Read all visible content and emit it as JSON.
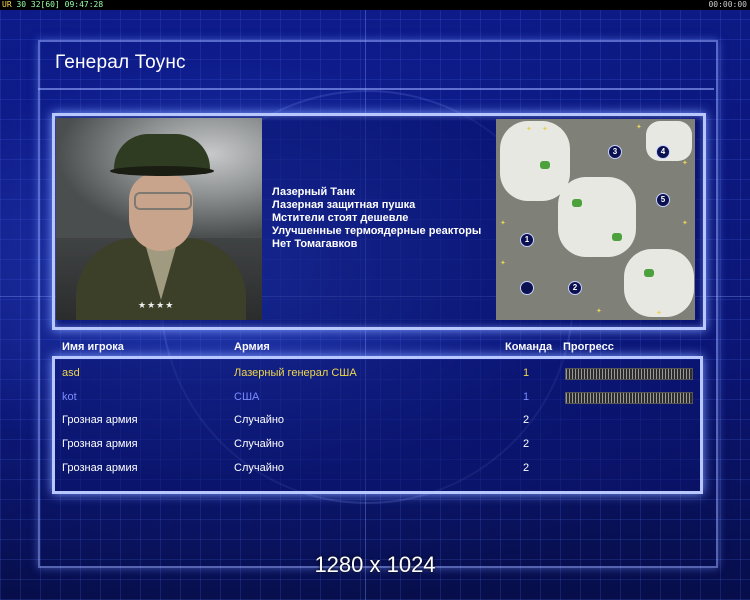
{
  "status_bar": {
    "left_prefix": "UR",
    "left_values": "30 32[60]",
    "clock": "09:47:28",
    "right_time": "00:00:00"
  },
  "title": "Генерал Тоунс",
  "general": {
    "features": [
      "Лазерный Танк",
      "Лазерная защитная пушка",
      "Мстители стоят дешевле",
      "Улучшенные термоядерные реакторы",
      "Нет Томагавков"
    ]
  },
  "map": {
    "slots": [
      "1",
      "2",
      "3",
      "4",
      "5",
      ""
    ]
  },
  "table": {
    "headers": {
      "player": "Имя игрока",
      "army": "Армия",
      "team": "Команда",
      "progress": "Прогресс"
    },
    "rows": [
      {
        "player": "asd",
        "army": "Лазерный генерал США",
        "team": "1",
        "progress": 1.0,
        "color": "#f0d64a"
      },
      {
        "player": "kot",
        "army": "США",
        "team": "1",
        "progress": 1.0,
        "color": "#7b8cff"
      },
      {
        "player": "Грозная армия",
        "army": "Случайно",
        "team": "2",
        "progress": null,
        "color": "#ffffff"
      },
      {
        "player": "Грозная армия",
        "army": "Случайно",
        "team": "2",
        "progress": null,
        "color": "#ffffff"
      },
      {
        "player": "Грозная армия",
        "army": "Случайно",
        "team": "2",
        "progress": null,
        "color": "#ffffff"
      }
    ]
  },
  "resolution": "1280 x 1024"
}
